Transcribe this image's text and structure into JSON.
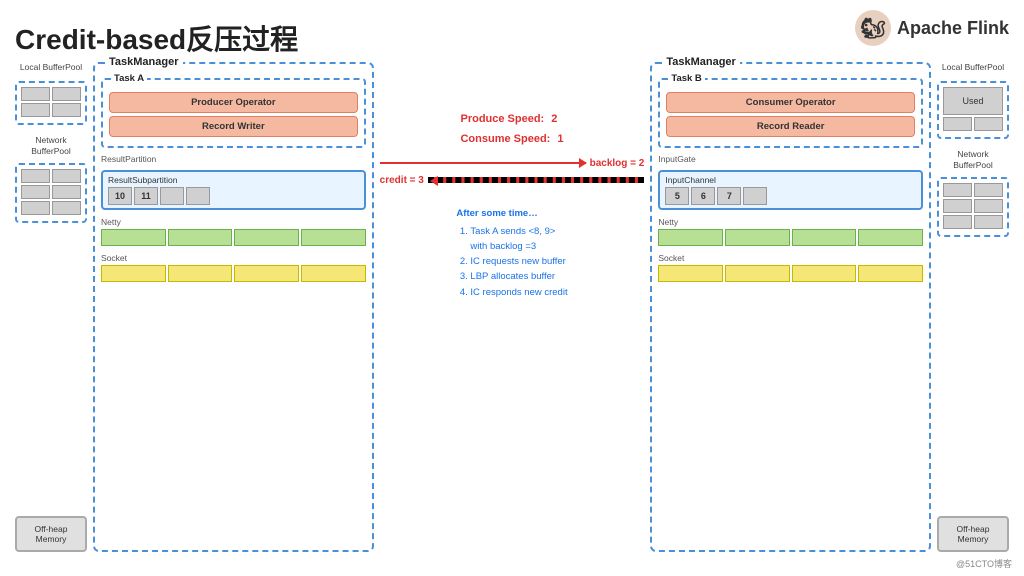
{
  "header": {
    "title": "Credit-based反压过程",
    "logo_text": "Apache Flink",
    "logo_icon": "🐿"
  },
  "left_tm": {
    "label": "TaskManager",
    "task_label": "Task A",
    "local_buffer_pool": "Local\nBufferPool",
    "network_buffer_pool": "Network\nBufferPool",
    "offheap": "Off-heap\nMemory",
    "producer_operator": "Producer\nOperator",
    "record_writer": "Record\nWriter",
    "result_partition_label": "ResultPartition",
    "result_subpartition_label": "ResultSubpartition",
    "buf1": "10",
    "buf2": "11",
    "netty_label": "Netty",
    "socket_label": "Socket"
  },
  "right_tm": {
    "label": "TaskManager",
    "task_label": "Task B",
    "local_buffer_pool": "Local\nBufferPool",
    "network_buffer_pool": "Network\nBufferPool",
    "offheap": "Off-heap\nMemory",
    "consumer_operator": "Consumer\nOperator",
    "record_reader": "Record\nReader",
    "input_gate_label": "InputGate",
    "input_channel_label": "InputChannel",
    "buf1": "5",
    "buf2": "6",
    "buf3": "7",
    "used_label": "Used",
    "netty_label": "Netty",
    "socket_label": "Socket"
  },
  "center": {
    "produce_speed_label": "Produce Speed:",
    "produce_speed_value": "2",
    "consume_speed_label": "Consume Speed:",
    "consume_speed_value": "1",
    "backlog_label": "backlog = 2",
    "credit_label": "credit = 3",
    "info_title": "After some time…",
    "info_items": [
      "Task A sends <8, 9> with backlog =3",
      "IC requests new buffer",
      "LBP allocates buffer",
      "IC responds new credit"
    ]
  }
}
